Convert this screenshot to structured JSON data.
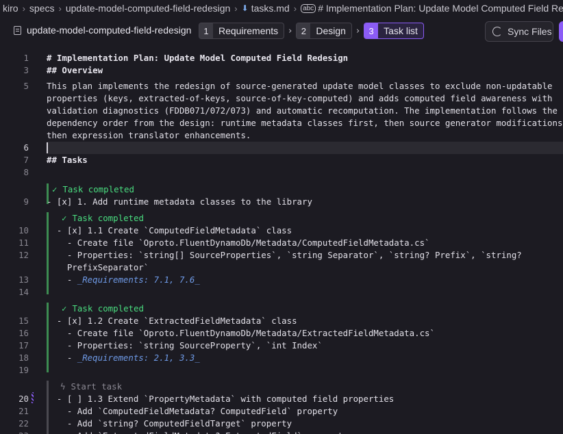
{
  "breadcrumb": {
    "items": [
      "kiro",
      "specs",
      "update-model-computed-field-redesign",
      "tasks.md",
      "# Implementation Plan: Update Model Computed Field Redes"
    ]
  },
  "toolbar": {
    "spec_name": "update-model-computed-field-redesign",
    "steps": [
      {
        "num": "1",
        "label": "Requirements"
      },
      {
        "num": "2",
        "label": "Design"
      },
      {
        "num": "3",
        "label": "Task list"
      }
    ],
    "sync_label": "Sync Files"
  },
  "lens": {
    "completed": "Task completed",
    "start": "Start task"
  },
  "editor": {
    "lines": [
      {
        "n": "1",
        "text": "# Implementation Plan: Update Model Computed Field Redesign"
      },
      {
        "n": "3",
        "text": "## Overview"
      },
      {
        "n": "5",
        "text": "This plan implements the redesign of source-generated update model classes to exclude non-updatable"
      },
      {
        "n": "",
        "text": "properties (keys, extracted-of-keys, source-of-key-computed) and adds computed field awareness with"
      },
      {
        "n": "",
        "text": "validation diagnostics (FDDB071/072/073) and automatic recomputation. The implementation follows the"
      },
      {
        "n": "",
        "text": "dependency order from the design: runtime metadata classes first, then source generator modifications,"
      },
      {
        "n": "",
        "text": "then expression translator enhancements."
      },
      {
        "n": "6",
        "text": ""
      },
      {
        "n": "7",
        "text": "## Tasks"
      },
      {
        "n": "8",
        "text": ""
      },
      {
        "n": "9",
        "text": "- [x] 1. Add runtime metadata classes to the library"
      },
      {
        "n": "10",
        "text": "  - [x] 1.1 Create `ComputedFieldMetadata` class"
      },
      {
        "n": "11",
        "text": "    - Create file `Oproto.FluentDynamoDb/Metadata/ComputedFieldMetadata.cs`"
      },
      {
        "n": "12",
        "text": "    - Properties: `string[] SourceProperties`, `string Separator`, `string? Prefix`, `string?"
      },
      {
        "n": "",
        "text": "    PrefixSeparator`"
      },
      {
        "n": "13",
        "text": "    - ",
        "link": "_Requirements: 7.1, 7.6_"
      },
      {
        "n": "14",
        "text": ""
      },
      {
        "n": "15",
        "text": "  - [x] 1.2 Create `ExtractedFieldMetadata` class"
      },
      {
        "n": "16",
        "text": "    - Create file `Oproto.FluentDynamoDb/Metadata/ExtractedFieldMetadata.cs`"
      },
      {
        "n": "17",
        "text": "    - Properties: `string SourceProperty`, `int Index`"
      },
      {
        "n": "18",
        "text": "    - ",
        "link": "_Requirements: 2.1, 3.3_"
      },
      {
        "n": "19",
        "text": ""
      },
      {
        "n": "20",
        "text": "  - [ ] 1.3 Extend `PropertyMetadata` with computed field properties"
      },
      {
        "n": "21",
        "text": "    - Add `ComputedFieldMetadata? ComputedField` property"
      },
      {
        "n": "22",
        "text": "    - Add `string? ComputedFieldTarget` property"
      },
      {
        "n": "23",
        "text": "    - Add `ExtractedFieldMetadata? ExtractedField` property"
      }
    ]
  },
  "colors": {
    "accent": "#8b5cf6",
    "completed": "#4ade80",
    "link": "#6f9be8",
    "background": "#1c1b22"
  }
}
